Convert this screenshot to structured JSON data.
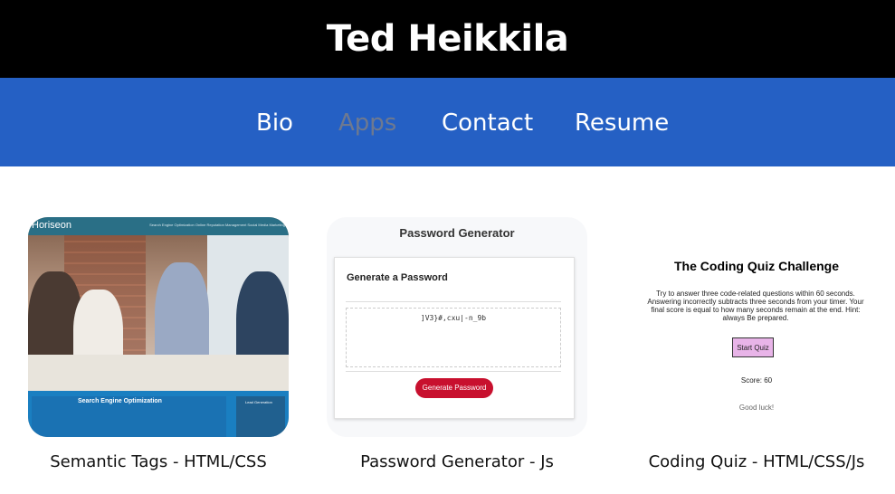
{
  "header": {
    "title": "Ted Heikkila"
  },
  "nav": {
    "items": [
      {
        "label": "Bio",
        "active": false
      },
      {
        "label": "Apps",
        "active": true
      },
      {
        "label": "Contact",
        "active": false
      },
      {
        "label": "Resume",
        "active": false
      }
    ]
  },
  "projects": [
    {
      "caption": "Semantic Tags - HTML/CSS",
      "preview": {
        "logo": "Horiseon",
        "links": "Search Engine Optimization   Online Reputation Management   Social Media Marketing",
        "banner_title": "Search Engine Optimization",
        "side_title": "Lead Generation"
      }
    },
    {
      "caption": "Password Generator - Js",
      "preview": {
        "title": "Password Generator",
        "panel_title": "Generate a Password",
        "password": "]V3}#,cxu|-n_9b",
        "button": "Generate Password"
      }
    },
    {
      "caption": "Coding Quiz - HTML/CSS/Js",
      "preview": {
        "title": "The Coding Quiz Challenge",
        "description": "Try to answer three code-related questions within 60 seconds. Answering incorrectly subtracts three seconds from your timer. Your final score is equal to how many seconds remain at the end. Hint: always Be prepared.",
        "button": "Start Quiz",
        "score": "Score: 60",
        "footer": "Good luck!"
      }
    }
  ],
  "colors": {
    "header_bg": "#000000",
    "nav_bg": "#2560c4",
    "nav_active": "#6e7990",
    "generate_button": "#c8102e",
    "quiz_button": "#e8b4e8"
  }
}
